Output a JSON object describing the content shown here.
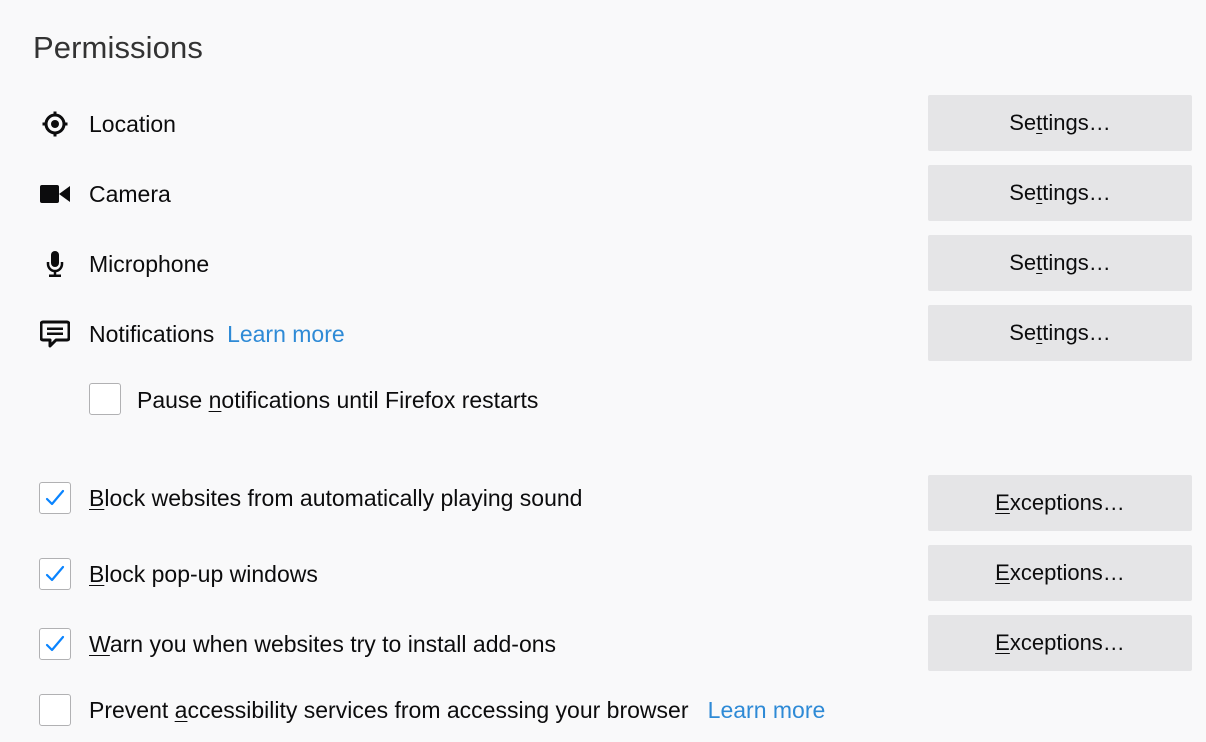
{
  "section": {
    "title": "Permissions"
  },
  "permissions": [
    {
      "label": "Location",
      "icon": "location-icon",
      "button": "Settings…"
    },
    {
      "label": "Camera",
      "icon": "camera-icon",
      "button": "Settings…"
    },
    {
      "label": "Microphone",
      "icon": "microphone-icon",
      "button": "Settings…"
    },
    {
      "label": "Notifications",
      "icon": "notification-icon",
      "button": "Settings…",
      "learn_more": "Learn more"
    }
  ],
  "pause_notifications": {
    "label_before": "Pause ",
    "label_accel": "n",
    "label_after": "otifications until Firefox restarts",
    "checked": false
  },
  "block_sound": {
    "label_accel": "B",
    "label_after": "lock websites from automatically playing sound",
    "checked": true,
    "button_accel": "E",
    "button_after": "xceptions…"
  },
  "block_popups": {
    "label_accel": "B",
    "label_after": "lock pop-up windows",
    "checked": true,
    "button_accel": "E",
    "button_after": "xceptions…"
  },
  "warn_addons": {
    "label_accel": "W",
    "label_after": "arn you when websites try to install add-ons",
    "checked": true,
    "button_accel": "E",
    "button_after": "xceptions…"
  },
  "prevent_accessibility": {
    "label_before": "Prevent ",
    "label_accel": "a",
    "label_after": "ccessibility services from accessing your browser",
    "learn_more": "Learn more",
    "checked": false
  },
  "settings_button": {
    "before": "Se",
    "accel": "t",
    "after": "tings…"
  },
  "colors": {
    "link": "#0a84ff",
    "check": "#0a84ff",
    "button_bg": "#e5e5e7",
    "page_bg": "#f9f9fa"
  }
}
